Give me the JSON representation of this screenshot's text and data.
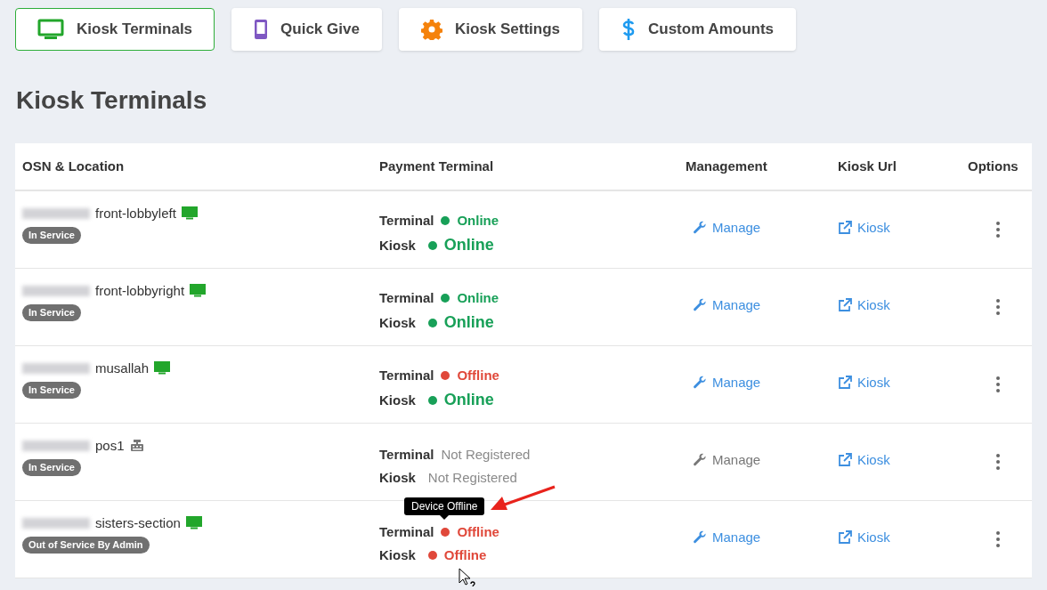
{
  "tabs": [
    {
      "label": "Kiosk Terminals",
      "kind": "monitor",
      "selected": true
    },
    {
      "label": "Quick Give",
      "kind": "phone",
      "selected": false
    },
    {
      "label": "Kiosk Settings",
      "kind": "gear",
      "selected": false
    },
    {
      "label": "Custom Amounts",
      "kind": "dollar",
      "selected": false
    }
  ],
  "heading": "Kiosk Terminals",
  "table": {
    "columns": [
      "OSN & Location",
      "Payment Terminal",
      "Management",
      "Kiosk Url",
      "Options"
    ],
    "rows": [
      {
        "location": "front-lobbyleft",
        "device": {
          "kind": "monitor"
        },
        "badge": "In Service",
        "terminal_label": "Terminal",
        "terminal_status": {
          "kind": "online",
          "text": "Online"
        },
        "kiosk_label": "Kiosk",
        "kiosk_status": {
          "kind": "online",
          "text": "Online"
        },
        "manage": {
          "label": "Manage",
          "disabled": false
        },
        "kiosk_link": "Kiosk"
      },
      {
        "location": "front-lobbyright",
        "device": {
          "kind": "monitor"
        },
        "badge": "In Service",
        "terminal_label": "Terminal",
        "terminal_status": {
          "kind": "online",
          "text": "Online"
        },
        "kiosk_label": "Kiosk",
        "kiosk_status": {
          "kind": "online",
          "text": "Online"
        },
        "manage": {
          "label": "Manage",
          "disabled": false
        },
        "kiosk_link": "Kiosk"
      },
      {
        "location": "musallah",
        "device": {
          "kind": "monitor"
        },
        "badge": "In Service",
        "terminal_label": "Terminal",
        "terminal_status": {
          "kind": "offline",
          "text": "Offline"
        },
        "kiosk_label": "Kiosk",
        "kiosk_status": {
          "kind": "online",
          "text": "Online"
        },
        "manage": {
          "label": "Manage",
          "disabled": false
        },
        "kiosk_link": "Kiosk"
      },
      {
        "location": "pos1",
        "device": {
          "kind": "register"
        },
        "badge": "In Service",
        "terminal_label": "Terminal",
        "terminal_status": {
          "kind": "unregistered",
          "text": "Not Registered"
        },
        "kiosk_label": "Kiosk",
        "kiosk_status": {
          "kind": "unregistered",
          "text": "Not Registered"
        },
        "manage": {
          "label": "Manage",
          "disabled": true
        },
        "kiosk_link": "Kiosk"
      },
      {
        "location": "sisters-section",
        "device": {
          "kind": "monitor"
        },
        "badge": "Out of Service By Admin",
        "terminal_label": "Terminal",
        "terminal_status": {
          "kind": "offline",
          "text": "Offline"
        },
        "kiosk_label": "Kiosk",
        "kiosk_status": {
          "kind": "offline",
          "text": "Offline"
        },
        "manage": {
          "label": "Manage",
          "disabled": false
        },
        "kiosk_link": "Kiosk",
        "tooltip": "Device Offline"
      }
    ]
  }
}
